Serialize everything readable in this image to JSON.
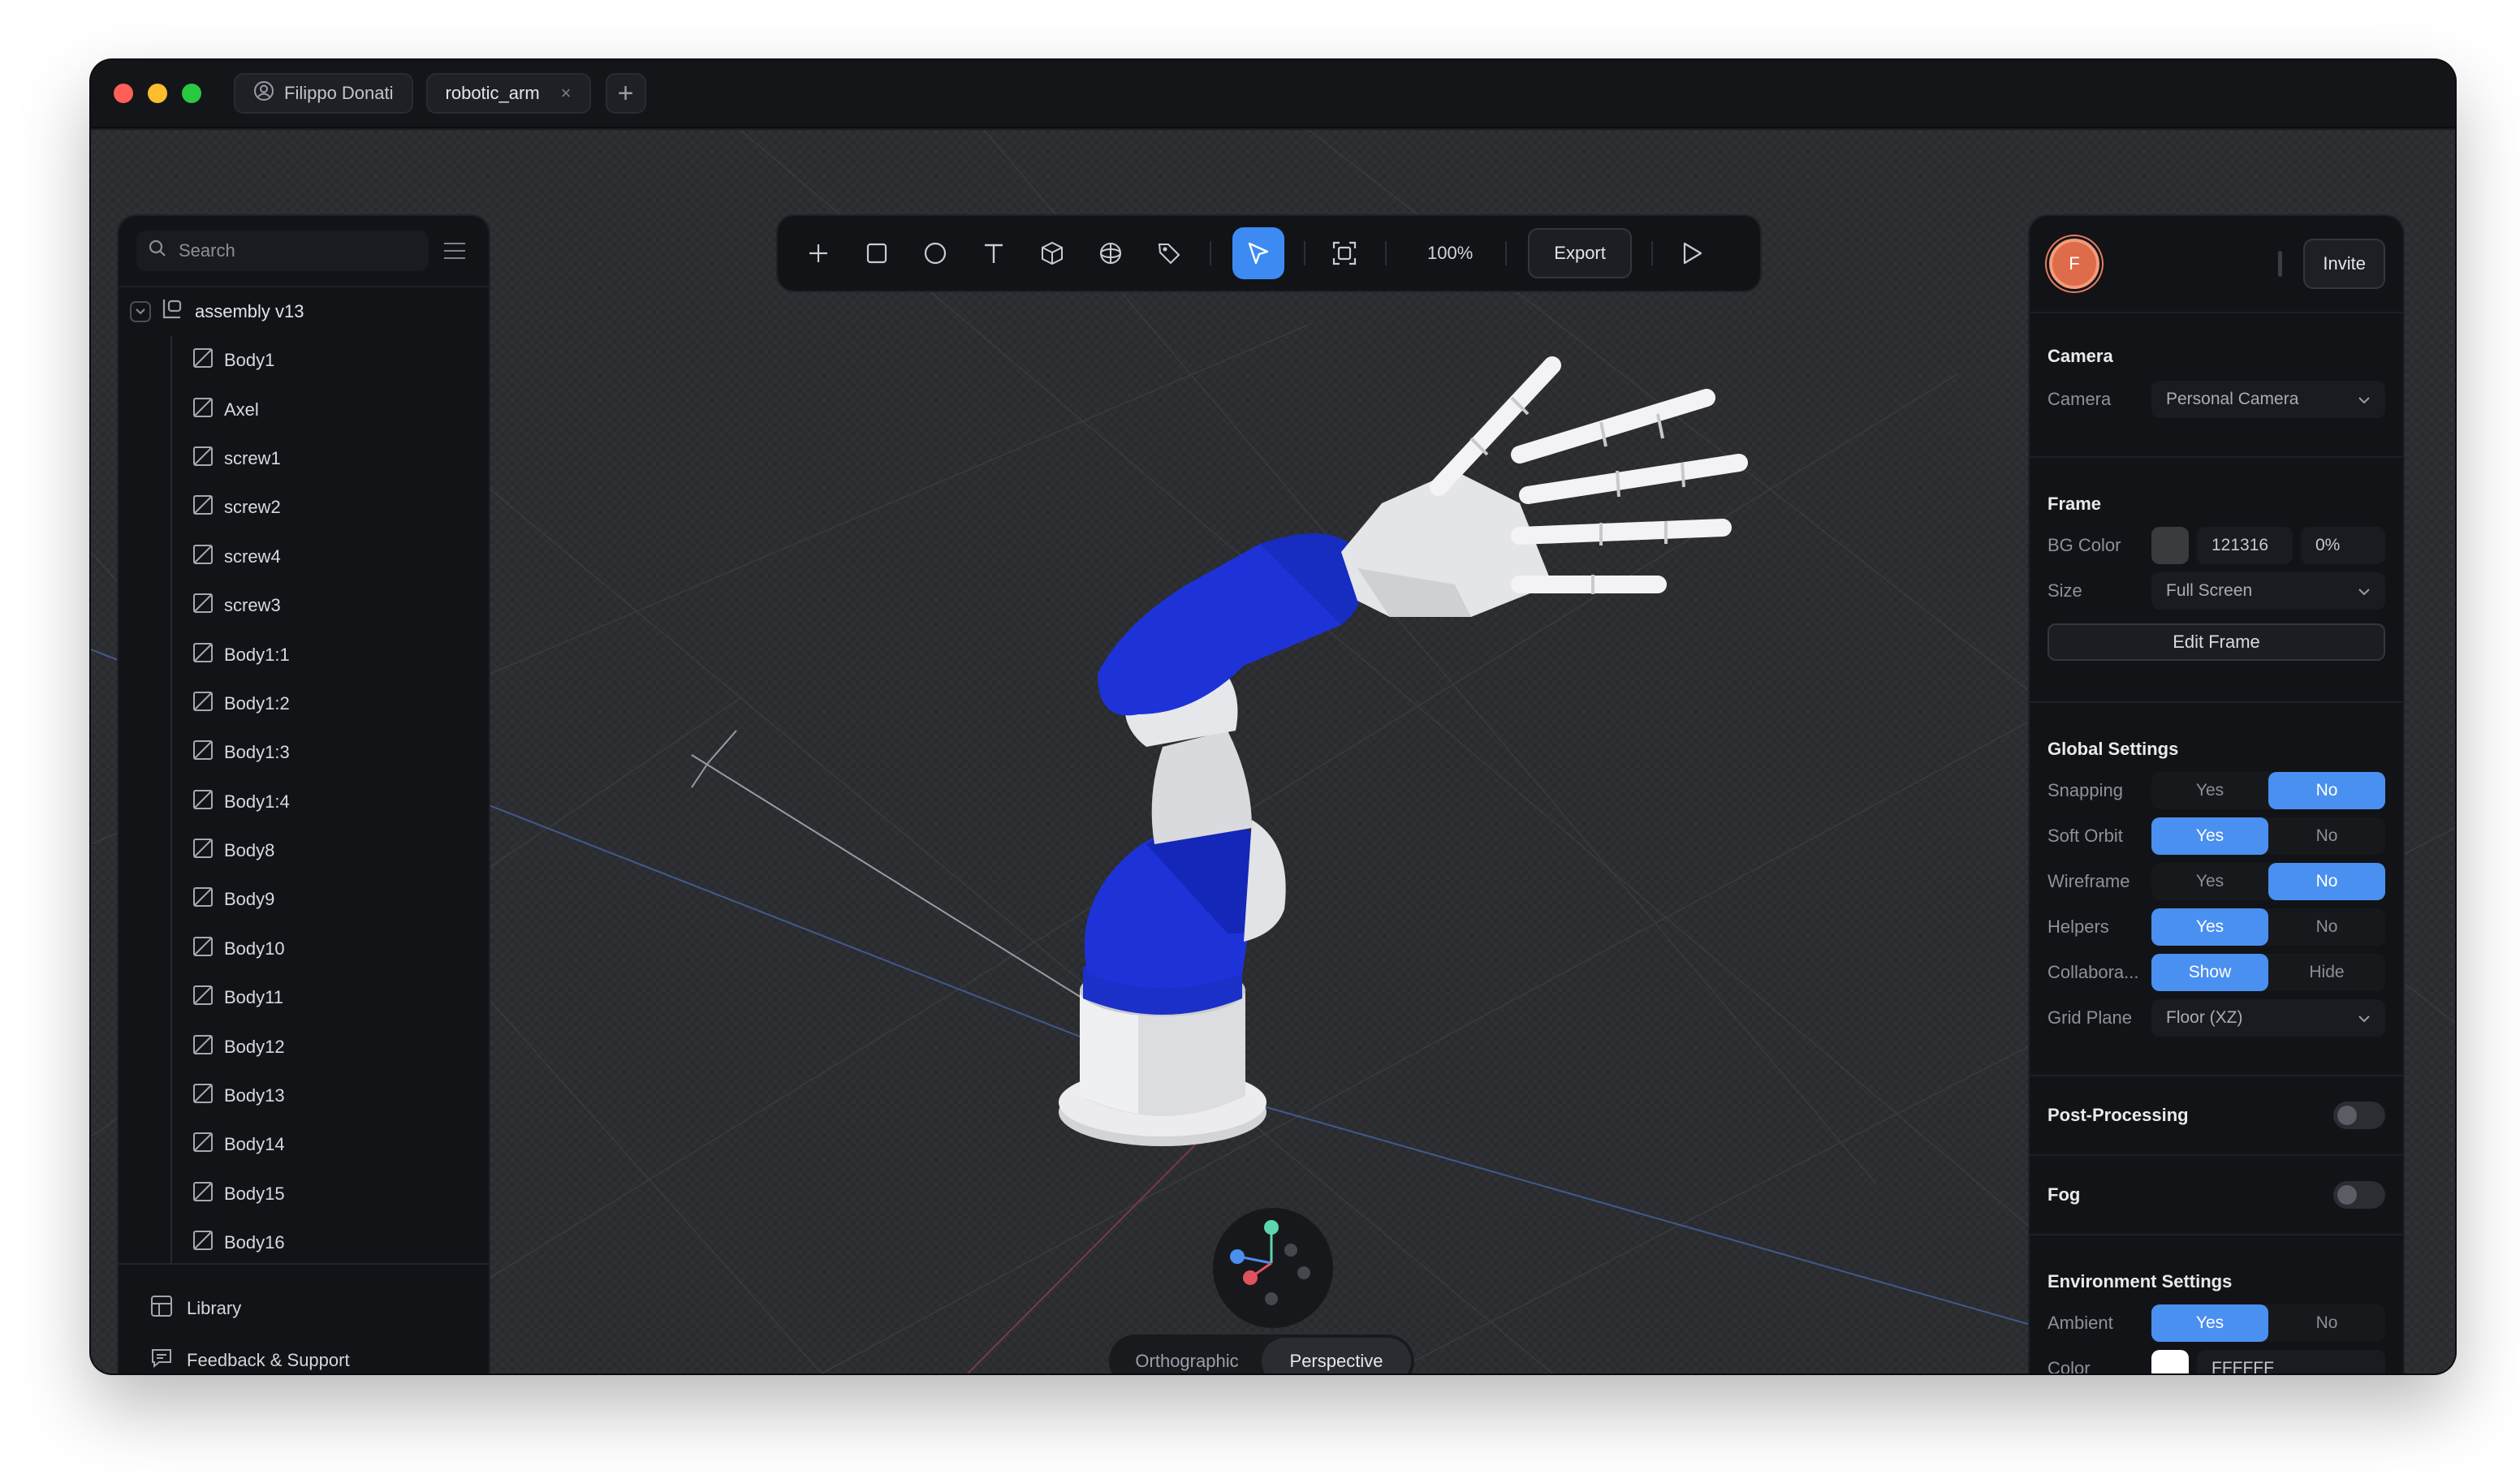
{
  "titlebar": {
    "user_name": "Filippo Donati",
    "file_tab": "robotic_arm",
    "close_glyph": "×",
    "add_glyph": "+"
  },
  "left_panel": {
    "search_placeholder": "Search",
    "root": "assembly v13",
    "items": [
      "Body1",
      "Axel",
      "screw1",
      "screw2",
      "screw4",
      "screw3",
      "Body1:1",
      "Body1:2",
      "Body1:3",
      "Body1:4",
      "Body8",
      "Body9",
      "Body10",
      "Body11",
      "Body12",
      "Body13",
      "Body14",
      "Body15",
      "Body16"
    ],
    "footer": {
      "library": "Library",
      "feedback": "Feedback & Support"
    }
  },
  "toolbar": {
    "tools": [
      "plus-icon",
      "rectangle-icon",
      "circle-icon",
      "text-icon",
      "cube-icon",
      "sphere-icon",
      "tag-icon",
      "pointer-icon",
      "frame-icon",
      "play-icon"
    ],
    "zoom": "100%",
    "export_label": "Export"
  },
  "projection": {
    "orthographic": "Orthographic",
    "perspective": "Perspective",
    "active": "Perspective"
  },
  "right_panel": {
    "avatar_letter": "F",
    "invite_label": "Invite",
    "camera": {
      "title": "Camera",
      "label": "Camera",
      "value": "Personal Camera"
    },
    "frame": {
      "title": "Frame",
      "bg_label": "BG Color",
      "bg_hex": "121316",
      "bg_opacity": "0%",
      "size_label": "Size",
      "size_value": "Full Screen",
      "edit_label": "Edit Frame"
    },
    "global": {
      "title": "Global Settings",
      "rows": [
        {
          "label": "Snapping",
          "a": "Yes",
          "b": "No",
          "selected": "b"
        },
        {
          "label": "Soft Orbit",
          "a": "Yes",
          "b": "No",
          "selected": "a"
        },
        {
          "label": "Wireframe",
          "a": "Yes",
          "b": "No",
          "selected": "b"
        },
        {
          "label": "Helpers",
          "a": "Yes",
          "b": "No",
          "selected": "a"
        },
        {
          "label": "Collabora...",
          "a": "Show",
          "b": "Hide",
          "selected": "a"
        }
      ],
      "grid_label": "Grid Plane",
      "grid_value": "Floor (XZ)"
    },
    "post_processing": "Post-Processing",
    "fog": "Fog",
    "environment": {
      "title": "Environment Settings",
      "ambient_label": "Ambient",
      "ambient_a": "Yes",
      "ambient_b": "No",
      "color_label": "Color",
      "color_hex": "FFFFFF"
    }
  },
  "colors": {
    "accent": "#4a90f0",
    "arm_blue": "#1d33d8",
    "arm_white": "#e6e7ea",
    "avatar": "#de6b4a"
  }
}
